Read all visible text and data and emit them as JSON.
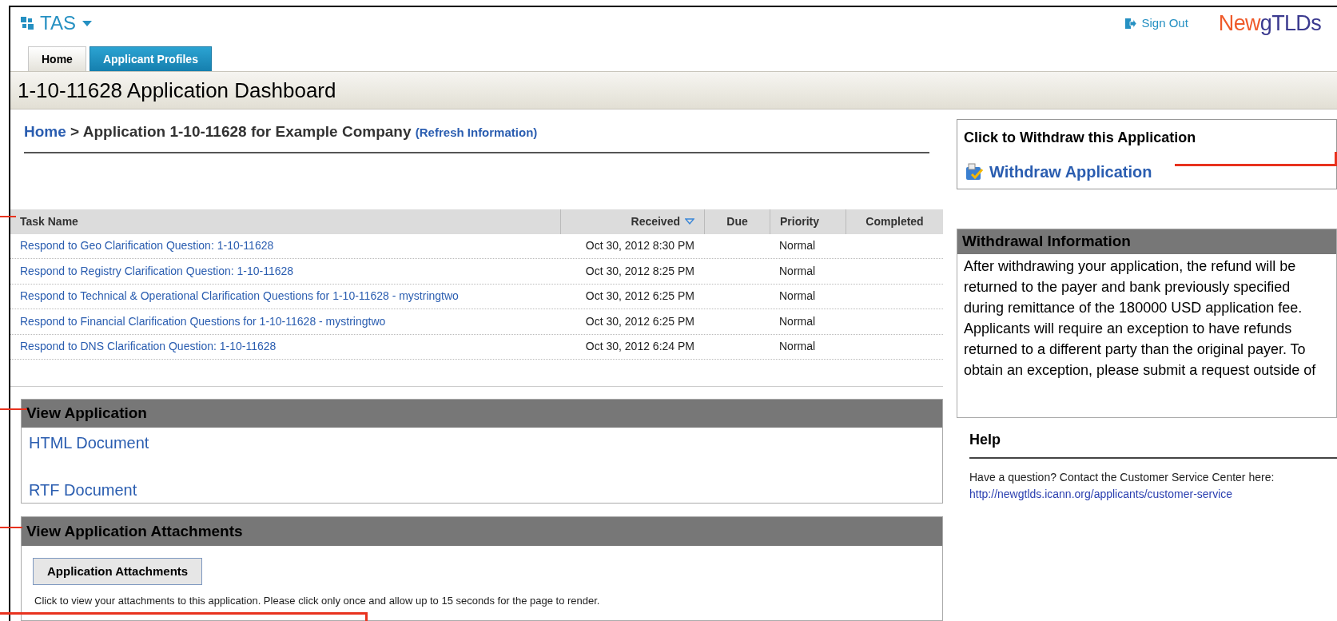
{
  "app": {
    "name": "TAS"
  },
  "header": {
    "sign_out": "Sign Out",
    "logo": [
      {
        "text": "New"
      },
      {
        "text": "gTLDs"
      }
    ]
  },
  "tabs": [
    {
      "label": "Home",
      "selected": true
    },
    {
      "label": "Applicant Profiles",
      "selected": false
    }
  ],
  "page_title": "1-10-11628 Application Dashboard",
  "breadcrumb": {
    "home": "Home",
    "current": "> Application 1-10-11628 for Example Company",
    "refresh": "(Refresh Information)"
  },
  "table": {
    "columns": [
      {
        "label": "Task Name",
        "sorted": false
      },
      {
        "label": "Received",
        "sorted": true
      },
      {
        "label": "Due",
        "sorted": false
      },
      {
        "label": "Priority",
        "sorted": false
      },
      {
        "label": "Completed",
        "sorted": false
      }
    ],
    "rows": [
      {
        "task": "Respond to Geo Clarification Question: 1-10-11628",
        "received": "Oct 30, 2012 8:30 PM",
        "priority": "Normal"
      },
      {
        "task": "Respond to Registry Clarification Question: 1-10-11628",
        "received": "Oct 30, 2012 8:25 PM",
        "priority": "Normal"
      },
      {
        "task": "Respond to Technical & Operational Clarification Questions for 1-10-11628 - mystringtwo",
        "received": "Oct 30, 2012 6:25 PM",
        "priority": "Normal"
      },
      {
        "task": "Respond to Financial Clarification Questions for 1-10-11628 - mystringtwo",
        "received": "Oct 30, 2012 6:25 PM",
        "priority": "Normal"
      },
      {
        "task": "Respond to DNS Clarification Question: 1-10-11628",
        "received": "Oct 30, 2012 6:24 PM",
        "priority": "Normal"
      }
    ]
  },
  "view_application": {
    "title": "View Application",
    "links": [
      "HTML Document",
      "RTF Document"
    ]
  },
  "attachments": {
    "title": "View Application Attachments",
    "button": "Application Attachments",
    "note": "Click to view your attachments to this application. Please click only once and allow up to 15 seconds for the page to render."
  },
  "withdraw": {
    "title": "Click to Withdraw this Application",
    "link": "Withdraw Application"
  },
  "withdrawal_info": {
    "title": "Withdrawal Information",
    "text": "After withdrawing your application, the refund will be returned to the payer and bank previously specified during remittance of the 180000 USD application fee. Applicants will require an exception to have refunds returned to a different party than the original payer. To obtain an exception, please submit a request outside of"
  },
  "help": {
    "title": "Help",
    "text": "Have a question?  Contact the Customer Service Center here:",
    "link": "http://newgtlds.icann.org/applicants/customer-service"
  }
}
